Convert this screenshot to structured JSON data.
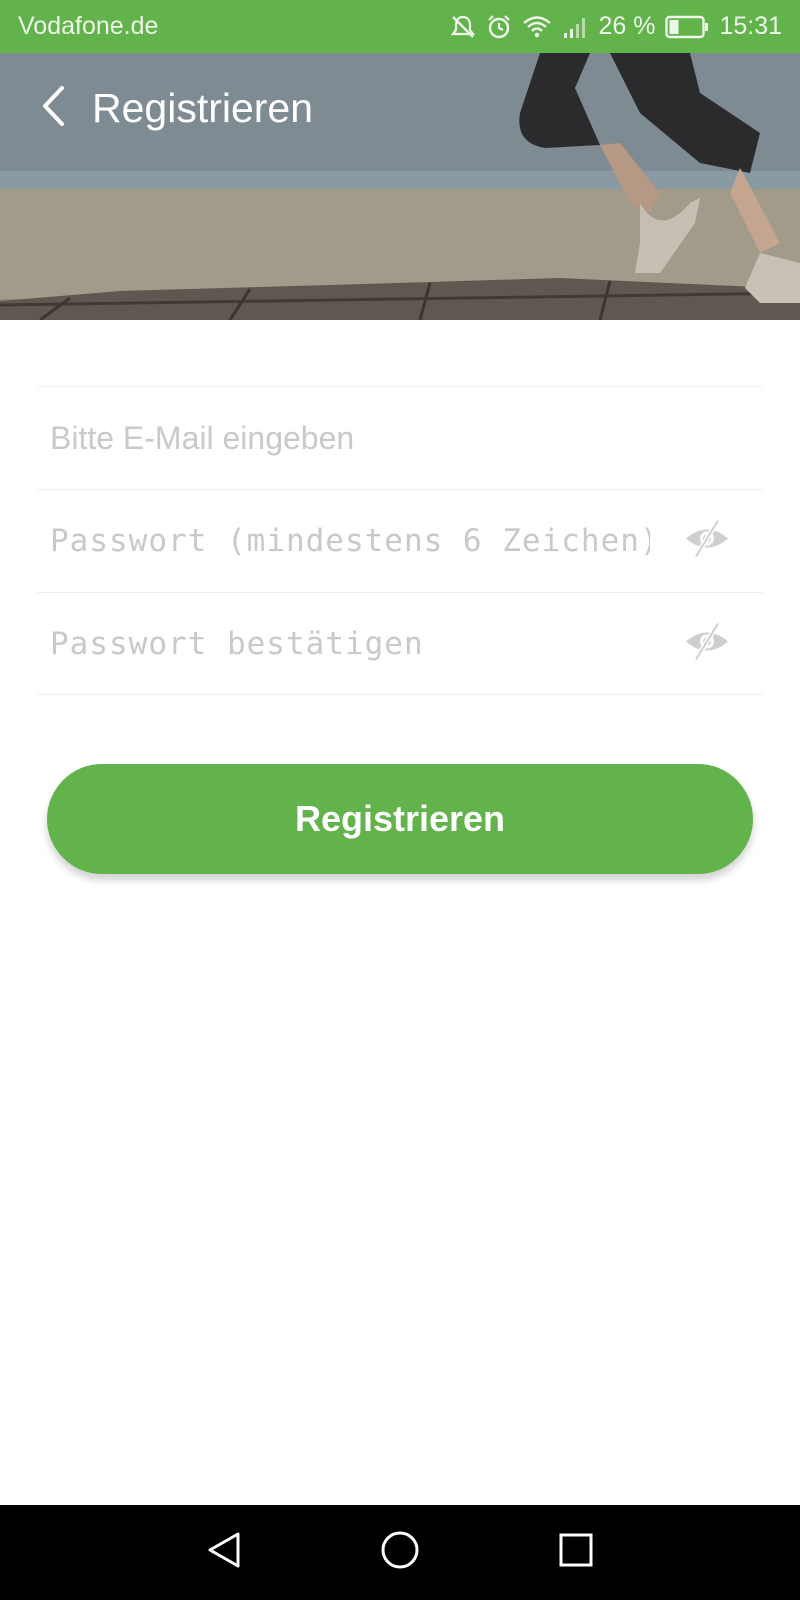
{
  "status_bar": {
    "carrier": "Vodafone.de",
    "battery": "26 %",
    "time": "15:31",
    "icons": [
      "mute-icon",
      "alarm-icon",
      "wifi-icon",
      "signal-icon",
      "battery-icon"
    ]
  },
  "header": {
    "title": "Registrieren",
    "back_icon": "chevron-left-icon"
  },
  "form": {
    "email_placeholder": "Bitte E-Mail eingeben",
    "password_placeholder": "Passwort (mindestens 6 Zeichen)",
    "confirm_placeholder": "Passwort bestätigen",
    "visibility_icon": "eye-off-icon"
  },
  "actions": {
    "register_label": "Registrieren"
  },
  "nav_bar": {
    "icons": [
      "back-triangle-icon",
      "home-circle-icon",
      "recents-square-icon"
    ]
  },
  "colors": {
    "accent": "#62b34b",
    "divider": "#ececec",
    "placeholder": "#c9c9c9"
  }
}
